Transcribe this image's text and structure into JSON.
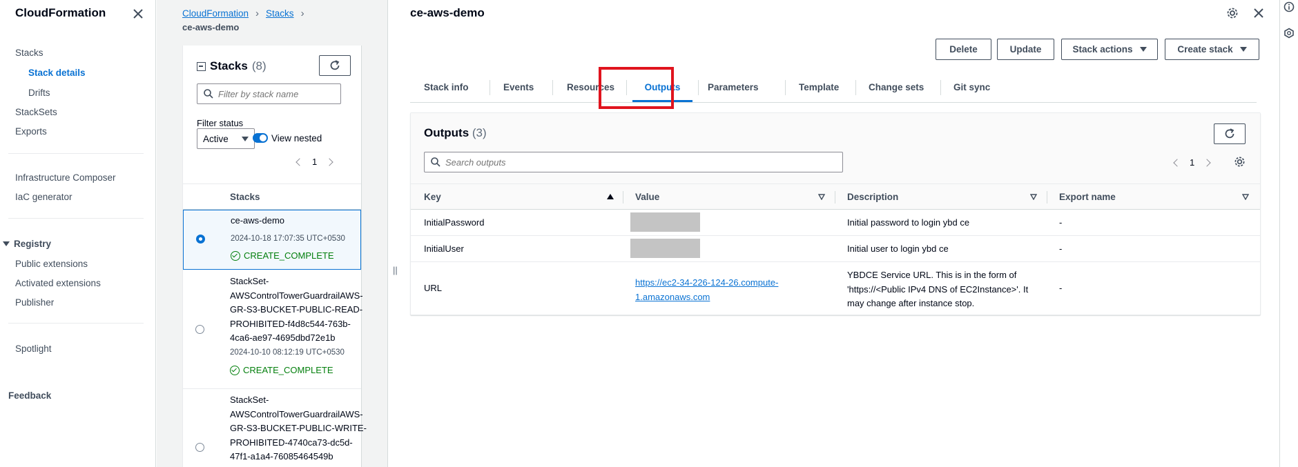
{
  "nav": {
    "title": "CloudFormation",
    "items": [
      {
        "label": "Stacks"
      },
      {
        "label": "Stack details"
      },
      {
        "label": "Drifts"
      },
      {
        "label": "StackSets"
      },
      {
        "label": "Exports"
      },
      {
        "label": "Infrastructure Composer"
      },
      {
        "label": "IaC generator"
      },
      {
        "label": "Registry"
      },
      {
        "label": "Public extensions"
      },
      {
        "label": "Activated extensions"
      },
      {
        "label": "Publisher"
      },
      {
        "label": "Spotlight"
      },
      {
        "label": "Feedback"
      }
    ]
  },
  "breadcrumb": {
    "items": [
      {
        "label": "CloudFormation"
      },
      {
        "label": "Stacks"
      }
    ],
    "current": "ce-aws-demo"
  },
  "stacks": {
    "title": "Stacks",
    "count": "(8)",
    "search_placeholder": "Filter by stack name",
    "filter_label": "Filter status",
    "filter_value": "Active",
    "view_nested_label": "View nested",
    "page": "1",
    "column_header": "Stacks",
    "items": [
      {
        "name_lines": [
          "ce-aws-demo"
        ],
        "date": "2024-10-18 17:07:35 UTC+0530",
        "status": "CREATE_COMPLETE"
      },
      {
        "name_lines": [
          "StackSet-",
          "AWSControlTowerGuardrailAWS-",
          "GR-S3-BUCKET-PUBLIC-READ-",
          "PROHIBITED-f4d8c544-763b-",
          "4ca6-ae97-4695dbd72e1b"
        ],
        "date": "2024-10-10 08:12:19 UTC+0530",
        "status": "CREATE_COMPLETE"
      },
      {
        "name_lines": [
          "StackSet-",
          "AWSControlTowerGuardrailAWS-",
          "GR-S3-BUCKET-PUBLIC-WRITE-",
          "PROHIBITED-4740ca73-dc5d-",
          "47f1-a1a4-76085464549b"
        ]
      }
    ]
  },
  "detail": {
    "title": "ce-aws-demo",
    "buttons": {
      "delete": "Delete",
      "update": "Update",
      "stack_actions": "Stack actions",
      "create_stack": "Create stack"
    },
    "tabs": [
      {
        "label": "Stack info"
      },
      {
        "label": "Events"
      },
      {
        "label": "Resources"
      },
      {
        "label": "Outputs"
      },
      {
        "label": "Parameters"
      },
      {
        "label": "Template"
      },
      {
        "label": "Change sets"
      },
      {
        "label": "Git sync"
      }
    ],
    "active_tab": "Outputs",
    "highlight_color": "#e0141e"
  },
  "outputs": {
    "title": "Outputs",
    "count": "(3)",
    "search_placeholder": "Search outputs",
    "page": "1",
    "columns": [
      "Key",
      "Value",
      "Description",
      "Export name"
    ],
    "rows": [
      {
        "key": "InitialPassword",
        "value": "",
        "value_masked": true,
        "description_lines": [
          "Initial password to login ybd ce"
        ],
        "export": "-"
      },
      {
        "key": "InitialUser",
        "value": "",
        "value_masked": true,
        "description_lines": [
          "Initial user to login ybd ce"
        ],
        "export": "-"
      },
      {
        "key": "URL",
        "value_lines": [
          "https://ec2-34-226-124-26.compute-",
          "1.amazonaws.com"
        ],
        "value_masked": false,
        "description_lines": [
          "YBDCE Service URL. This is in the form of",
          "'https://<Public IPv4 DNS of EC2Instance>'. It",
          "may change after instance stop."
        ],
        "export": "-"
      }
    ]
  },
  "colors": {
    "accent": "#0972d3",
    "success": "#037f0c",
    "text": "#000716"
  }
}
